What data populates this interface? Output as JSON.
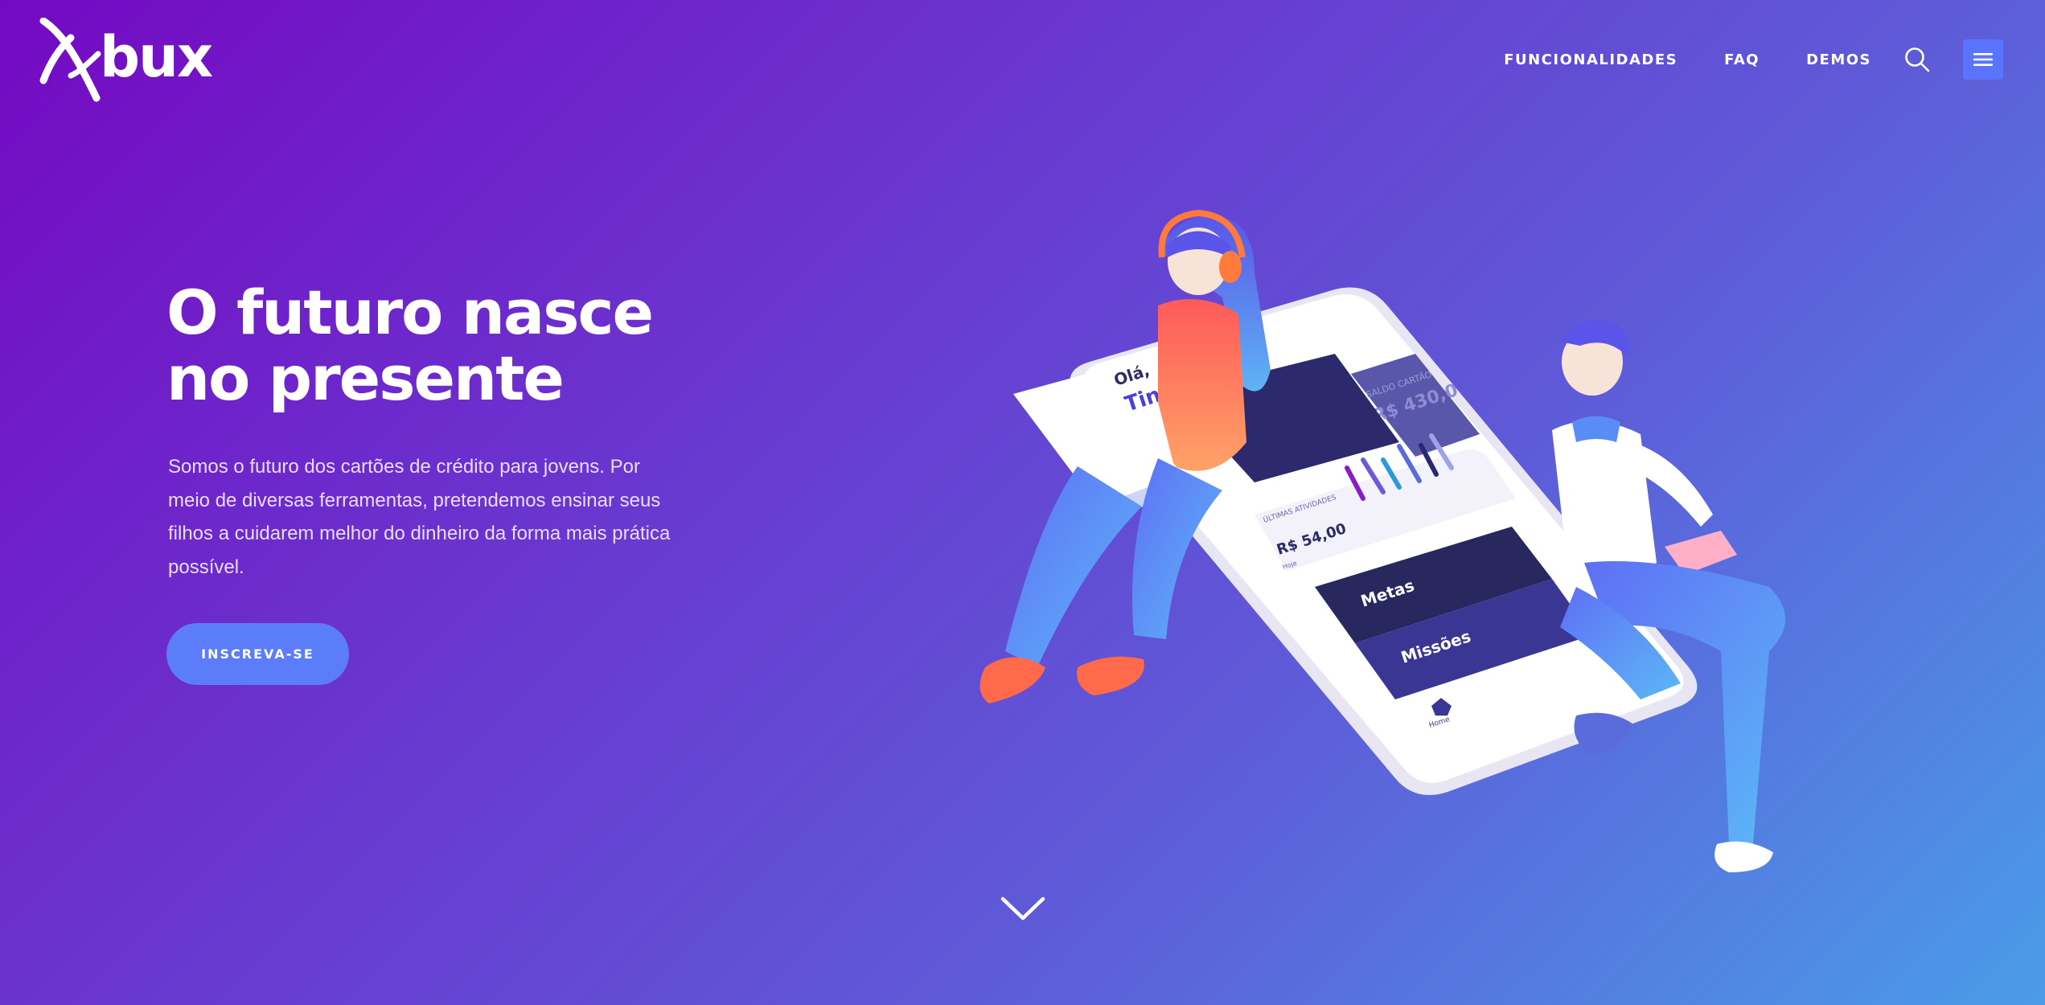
{
  "brand": {
    "name": "bux"
  },
  "nav": {
    "items": [
      {
        "label": "FUNCIONALIDADES"
      },
      {
        "label": "FAQ"
      },
      {
        "label": "DEMOS"
      }
    ]
  },
  "hero": {
    "title_line1": "O futuro nasce",
    "title_line2": "no presente",
    "description": "Somos o futuro dos cartões de crédito para jovens. Por meio de diversas ferramentas, pretendemos ensinar seus filhos a cuidarem melhor do dinheiro da forma mais prática possível.",
    "cta_label": "INSCREVA-SE"
  },
  "illustration": {
    "greeting": "Olá,",
    "name_partial": "Tin",
    "card_label": "SALDO CARTÃO",
    "card_balance": "R$ 430,0",
    "activities_label": "ÚLTIMAS ATIVIDADES",
    "activity_value": "R$ 54,00",
    "activity_note": "Hoje",
    "menu_goals": "Metas",
    "menu_missions": "Missões",
    "tab_home": "Home"
  },
  "colors": {
    "accent": "#5a74ff",
    "cta": "#5b7dfa",
    "gradient_start": "#7409c2",
    "gradient_end": "#4a9ce8"
  },
  "icons": {
    "search": "search-icon",
    "menu": "hamburger-menu-icon",
    "scroll": "chevron-down-icon"
  }
}
